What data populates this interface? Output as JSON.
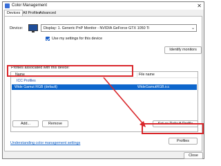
{
  "window": {
    "title": "Color Management",
    "close_glyph": "✕"
  },
  "tabs": [
    {
      "label": "Devices",
      "active": true
    },
    {
      "label": "All Profiles",
      "active": false
    },
    {
      "label": "Advanced",
      "active": false
    }
  ],
  "device": {
    "label": "Device:",
    "selected": "Display: 1. Generic PnP Monitor - NVIDIA GeForce GTX 1050 Ti",
    "use_settings_label": "Use my settings for this device",
    "use_settings_checked": true,
    "identify_button": "Identify monitors"
  },
  "profiles": {
    "group_label": "Profiles associated with this device:",
    "columns": {
      "name": "Name",
      "file": "File name"
    },
    "group_name": "ICC Profiles",
    "rows": [
      {
        "name": "Wide Gamut RGB (default)",
        "file": "WideGamutRGB.icc",
        "selected": true
      }
    ]
  },
  "buttons": {
    "add": "Add...",
    "remove": "Remove",
    "set_default": "Set as Default Profile",
    "profiles": "Profiles",
    "close": "Close"
  },
  "link_text": "Understanding color management settings",
  "colors": {
    "accent": "#0d66cc",
    "highlight": "#d9262a",
    "link": "#0b5cc4"
  }
}
